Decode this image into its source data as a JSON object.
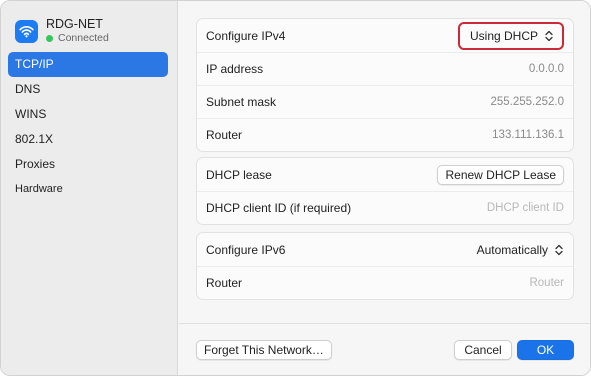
{
  "network": {
    "name": "RDG-NET",
    "status": "Connected",
    "icon": "wifi-icon"
  },
  "sidebar": {
    "items": [
      {
        "label": "TCP/IP",
        "selected": true
      },
      {
        "label": "DNS",
        "selected": false
      },
      {
        "label": "WINS",
        "selected": false
      },
      {
        "label": "802.1X",
        "selected": false
      },
      {
        "label": "Proxies",
        "selected": false
      },
      {
        "label": "Hardware",
        "selected": false
      }
    ]
  },
  "ipv4": {
    "configure_label": "Configure IPv4",
    "configure_value": "Using DHCP",
    "ip_label": "IP address",
    "ip_value": "0.0.0.0",
    "subnet_label": "Subnet mask",
    "subnet_value": "255.255.252.0",
    "router_label": "Router",
    "router_value": "133.111.136.1"
  },
  "dhcp": {
    "lease_label": "DHCP lease",
    "renew_button": "Renew DHCP Lease",
    "client_id_label": "DHCP client ID (if required)",
    "client_id_placeholder": "DHCP client ID"
  },
  "ipv6": {
    "configure_label": "Configure IPv6",
    "configure_value": "Automatically",
    "router_label": "Router",
    "router_placeholder": "Router"
  },
  "footer": {
    "forget_button": "Forget This Network…",
    "cancel_button": "Cancel",
    "ok_button": "OK"
  },
  "colors": {
    "accent": "#2b78e4",
    "highlight_border": "#cc2a3b",
    "status_green": "#34c759"
  }
}
